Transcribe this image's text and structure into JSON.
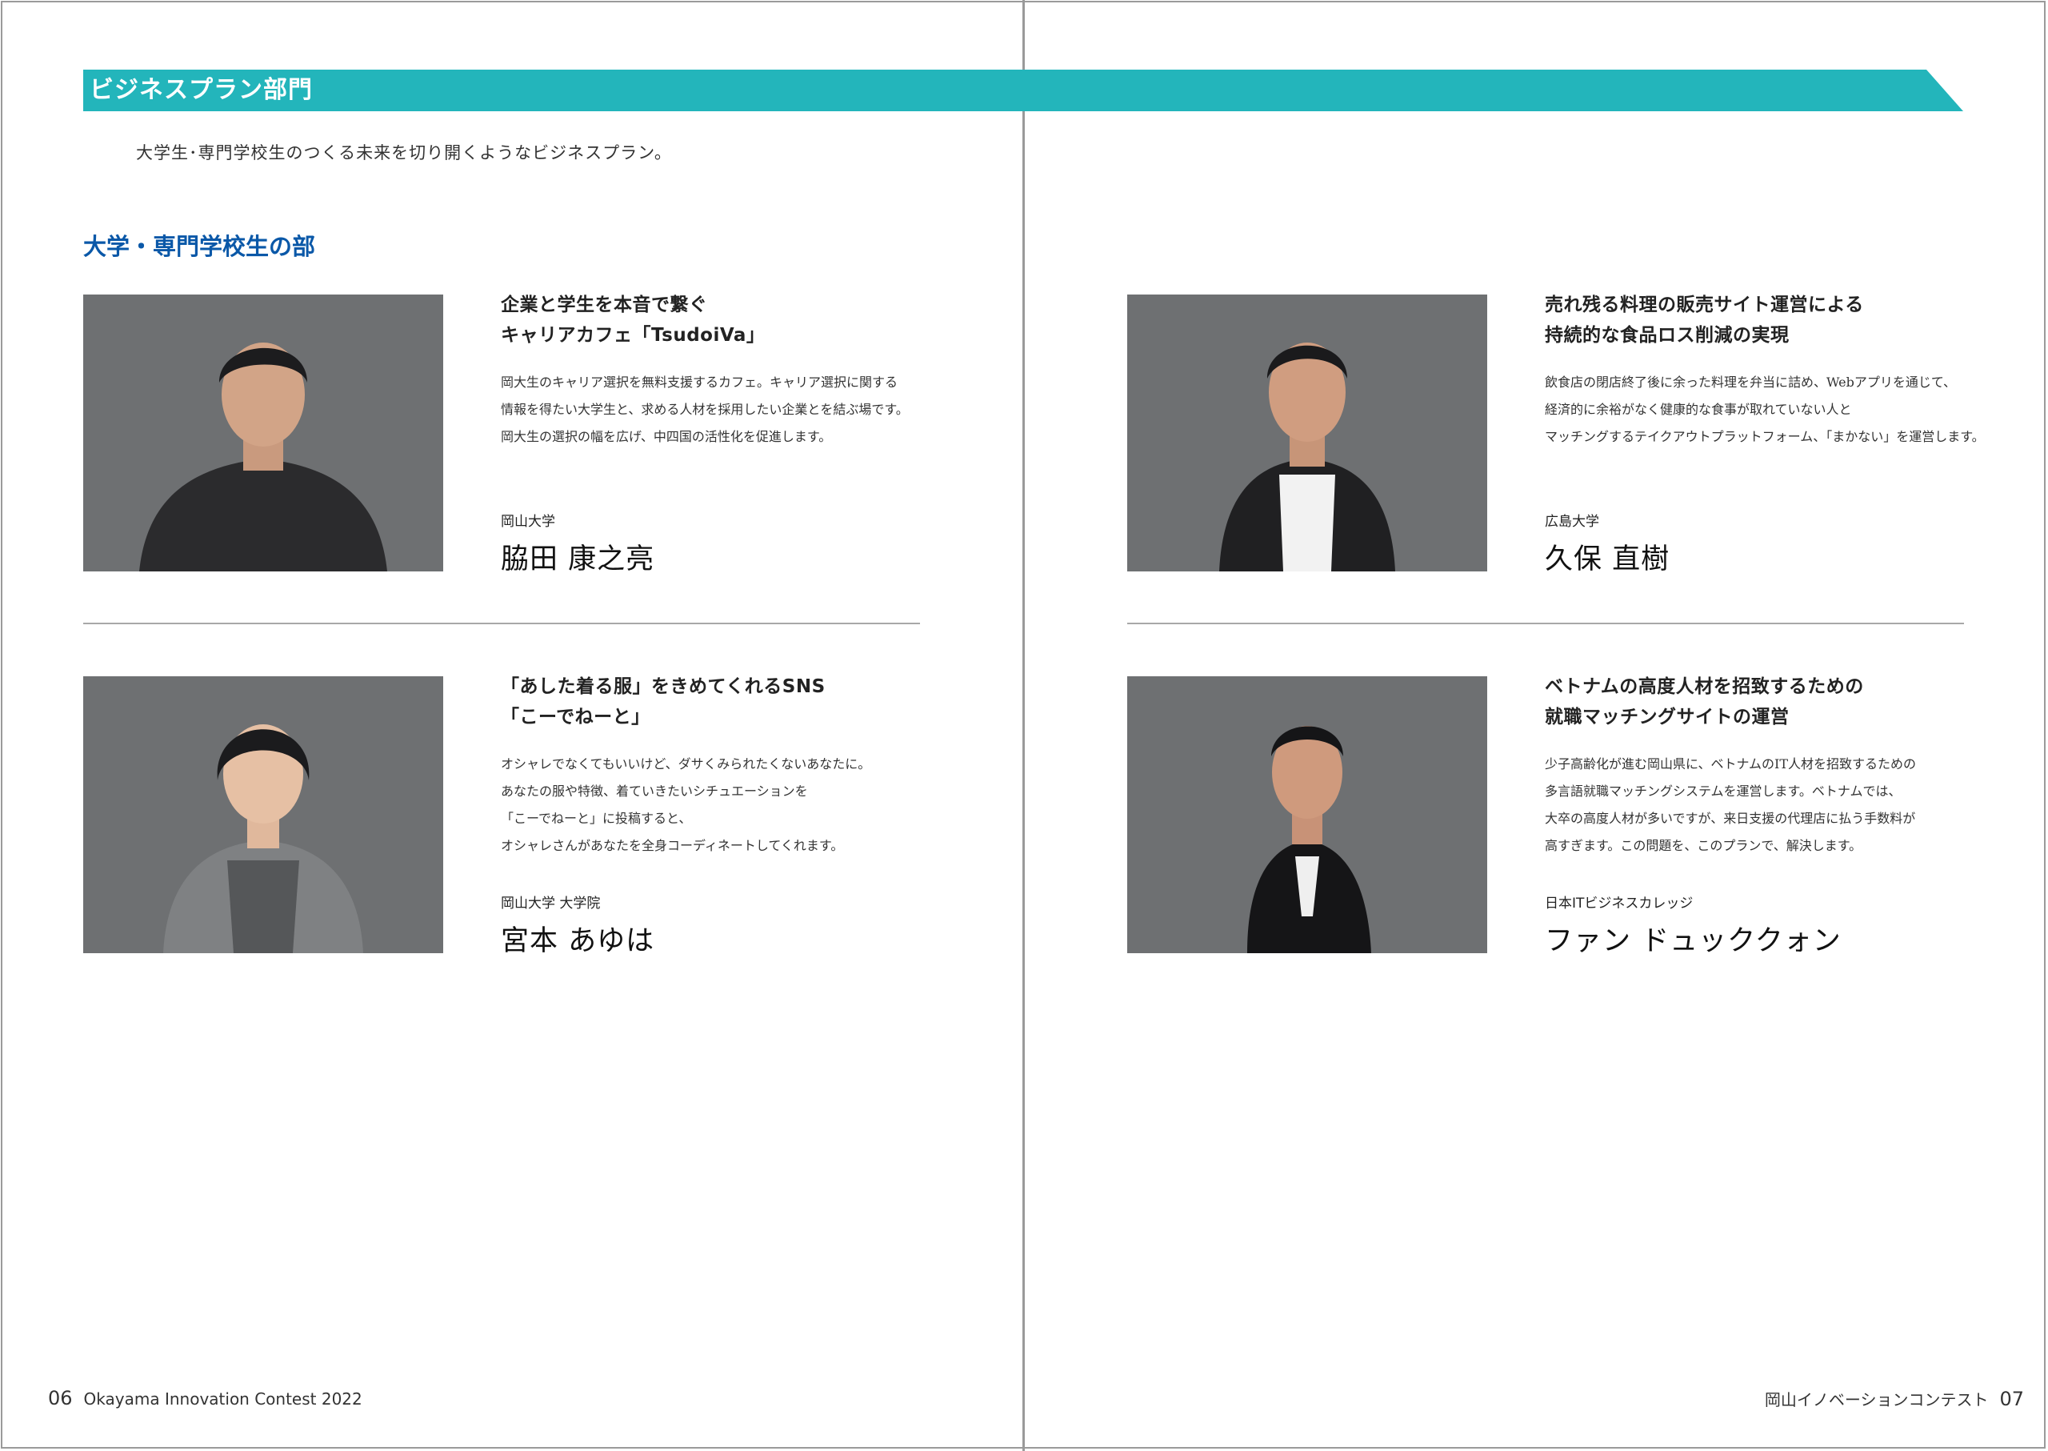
{
  "banner": {
    "title": "ビジネスプラン部門",
    "color": "#23b5bb"
  },
  "intro": "大学生･専門学校生のつくる未来を切り開くようなビジネスプラン。",
  "section": {
    "title": "大学・専門学校生の部",
    "color": "#0a58a8"
  },
  "entries": [
    {
      "title_lines": [
        "企業と学生を本音で繋ぐ",
        "キャリアカフェ「TsudoiVa」"
      ],
      "description_lines": [
        "岡大生のキャリア選択を無料支援するカフェ。キャリア選択に関する",
        "情報を得たい大学生と、求める人材を採用したい企業とを結ぶ場です。",
        "岡大生の選択の幅を広げ、中四国の活性化を促進します。"
      ],
      "affiliation": "岡山大学",
      "name": "脇田 康之亮"
    },
    {
      "title_lines": [
        "売れ残る料理の販売サイト運営による",
        "持続的な食品ロス削減の実現"
      ],
      "description_lines": [
        "飲食店の閉店終了後に余った料理を弁当に詰め、Webアプリを通じて、",
        "経済的に余裕がなく健康的な食事が取れていない人と",
        "マッチングするテイクアウトプラットフォーム、「まかない」を運営します。"
      ],
      "affiliation": "広島大学",
      "name": "久保 直樹"
    },
    {
      "title_lines": [
        "「あした着る服」をきめてくれるSNS",
        "「こーでねーと」"
      ],
      "description_lines": [
        "オシャレでなくてもいいけど、ダサくみられたくないあなたに。",
        "あなたの服や特徴、着ていきたいシチュエーションを",
        "「こーでねーと」に投稿すると、",
        "オシャレさんがあなたを全身コーディネートしてくれます。"
      ],
      "affiliation": "岡山大学 大学院",
      "name": "宮本 あゆは"
    },
    {
      "title_lines": [
        "ベトナムの高度人材を招致するための",
        "就職マッチングサイトの運営"
      ],
      "description_lines": [
        "少子高齢化が進む岡山県に、ベトナムのIT人材を招致するための",
        "多言語就職マッチングシステムを運営します。ベトナムでは、",
        "大卒の高度人材が多いですが、来日支援の代理店に払う手数料が",
        "高すぎます。この問題を、このプランで、解決します。"
      ],
      "affiliation": "日本ITビジネスカレッジ",
      "name": "ファン ドュッククォン"
    }
  ],
  "footer": {
    "left_page": "06",
    "left_text": "Okayama Innovation Contest 2022",
    "right_text": "岡山イノベーションコンテスト",
    "right_page": "07"
  }
}
